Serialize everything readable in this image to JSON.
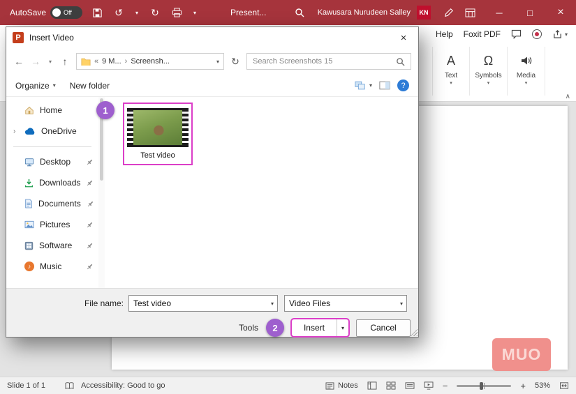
{
  "colors": {
    "titlebar_red": "#A6343C",
    "kn_red": "#C00F2D",
    "accent_magenta": "#DB3EC8",
    "accent_purple": "#9E5FCE",
    "muo_pink": "#F0908C"
  },
  "icons": {
    "caret_down": "▾",
    "back": "←",
    "forward": "→",
    "up": "↑",
    "refresh": "↻",
    "undo": "↺",
    "redo": "↻",
    "chevrons_left": "«",
    "chevron_right": "›",
    "expander": "›",
    "collapse_ribbon": "∧",
    "minimize": "─",
    "maximize": "□",
    "close": "×",
    "zoom_out": "−",
    "zoom_in": "+",
    "music_note": "♪",
    "help_mark": "?",
    "omega": "Ω",
    "text_a": "A",
    "ppt_p": "P"
  },
  "titlebar": {
    "autosave_label": "AutoSave",
    "autosave_state": "Off",
    "doc_title": "Present...",
    "user_name": "Kawusara Nurudeen Salley",
    "user_initials": "KN"
  },
  "menubar": {
    "items": [
      {
        "label": "Help"
      },
      {
        "label": "Foxit PDF"
      }
    ]
  },
  "ribbon": {
    "groups": [
      {
        "label": "Text"
      },
      {
        "label": "Symbols"
      },
      {
        "label": "Media"
      }
    ]
  },
  "dialog": {
    "title": "Insert Video",
    "nav": {
      "breadcrumb_prefix": "«",
      "breadcrumb": [
        {
          "label": "9 M..."
        },
        {
          "label": "Screensh..."
        }
      ],
      "search_placeholder": "Search Screenshots 15"
    },
    "toolbar": {
      "organize_label": "Organize",
      "new_folder_label": "New folder"
    },
    "sidebar": {
      "items": [
        {
          "label": "Home"
        },
        {
          "label": "OneDrive"
        },
        {
          "label": "Desktop"
        },
        {
          "label": "Downloads"
        },
        {
          "label": "Documents"
        },
        {
          "label": "Pictures"
        },
        {
          "label": "Software"
        },
        {
          "label": "Music"
        }
      ]
    },
    "files": [
      {
        "name": "Test video"
      }
    ],
    "callouts": {
      "step1": "1",
      "step2": "2"
    },
    "footer": {
      "file_name_label": "File name:",
      "file_name_value": "Test video",
      "file_type_value": "Video Files",
      "tools_label": "Tools",
      "insert_label": "Insert",
      "cancel_label": "Cancel"
    }
  },
  "statusbar": {
    "slide_indicator": "Slide 1 of 1",
    "accessibility_status": "Accessibility: Good to go",
    "notes_label": "Notes",
    "zoom_percent": "53%"
  },
  "watermark": {
    "text": "MUO"
  }
}
